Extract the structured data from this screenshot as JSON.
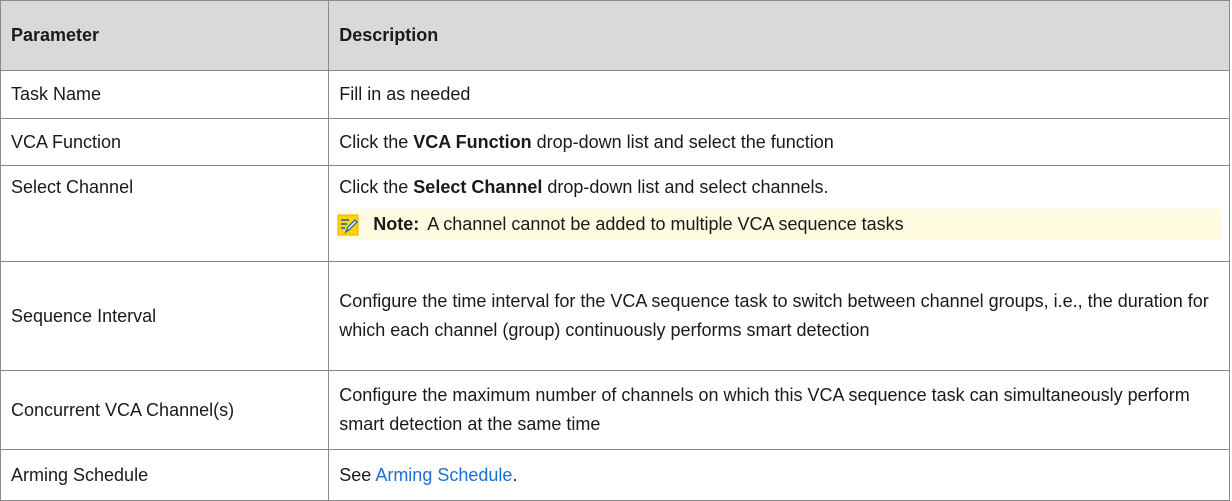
{
  "header": {
    "parameter": "Parameter",
    "description": "Description"
  },
  "rows": [
    {
      "param": "Task Name",
      "desc": "Fill in as needed"
    },
    {
      "param": "VCA Function",
      "desc_prefix": "Click the ",
      "desc_bold": "VCA Function",
      "desc_suffix": " drop-down list and select the function"
    },
    {
      "param": "Select Channel",
      "desc_prefix": "Click the ",
      "desc_bold": "Select Channel",
      "desc_suffix": " drop-down list and select channels.",
      "note_label": "Note:",
      "note_text": "A channel cannot be added to multiple VCA sequence tasks",
      "note_icon": "note-pencil-icon",
      "note_bg": "#fffbe0"
    },
    {
      "param": "Sequence Interval",
      "desc": "Configure the time interval for the VCA sequence task to switch between channel groups, i.e., the duration for which each channel (group) continuously performs smart detection"
    },
    {
      "param": "Concurrent VCA Channel(s)",
      "desc": "Configure the maximum number of channels on which this VCA sequence task can simultaneously perform smart detection at the same time"
    },
    {
      "param": "Arming Schedule",
      "desc_prefix": "See ",
      "link_text": "Arming Schedule",
      "desc_suffix": "."
    }
  ],
  "colors": {
    "header_bg": "#d9d9d9",
    "border": "#8a8a8a",
    "link": "#1a6fd6"
  }
}
